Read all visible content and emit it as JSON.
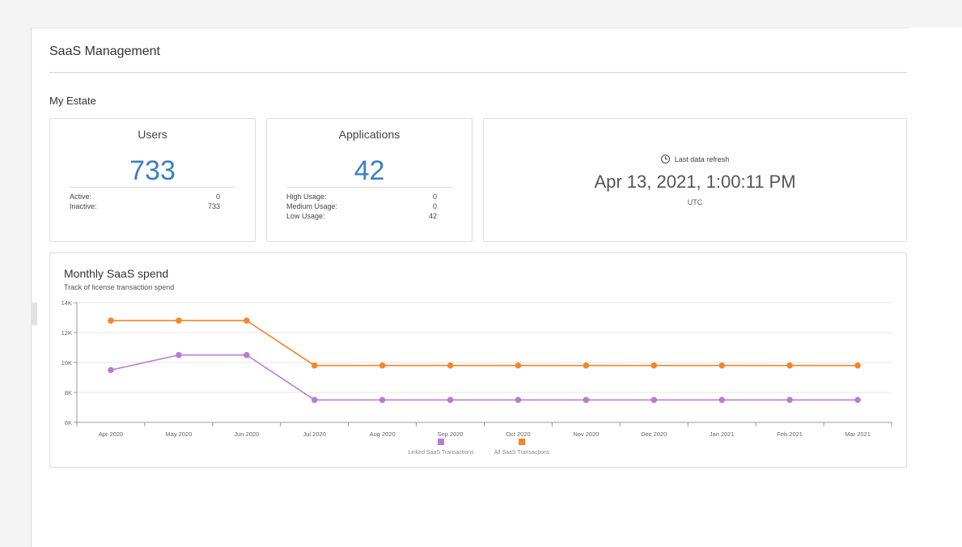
{
  "page": {
    "title": "SaaS Management",
    "section_title": "My Estate"
  },
  "users_card": {
    "heading": "Users",
    "total": "733",
    "rows": [
      {
        "label": "Active:",
        "value": "0"
      },
      {
        "label": "Inactive:",
        "value": "733"
      }
    ]
  },
  "apps_card": {
    "heading": "Applications",
    "total": "42",
    "rows": [
      {
        "label": "High Usage:",
        "value": "0"
      },
      {
        "label": "Medium Usage:",
        "value": "0"
      },
      {
        "label": "Low Usage:",
        "value": "42"
      }
    ]
  },
  "refresh_card": {
    "label": "Last data refresh",
    "value": "Apr 13, 2021, 1:00:11 PM",
    "timezone": "UTC",
    "icon": "clock-icon"
  },
  "colors": {
    "accent_number": "#3b7fc4",
    "linked_series": "#b57bd6",
    "all_series": "#f4852a"
  },
  "chart_data": {
    "type": "line",
    "title": "Monthly SaaS spend",
    "subtitle": "Track of license transaction spend",
    "categories": [
      "Apr 2020",
      "May 2020",
      "Jun 2020",
      "Jul 2020",
      "Aug 2020",
      "Sep 2020",
      "Oct 2020",
      "Nov 2020",
      "Dec 2020",
      "Jan 2021",
      "Feb 2021",
      "Mar 2021"
    ],
    "y_ticks": [
      "6K",
      "8K",
      "10K",
      "12K",
      "14K"
    ],
    "ylim": [
      6000,
      14000
    ],
    "series": [
      {
        "name": "Linked SaaS Transactions",
        "color": "#b57bd6",
        "values": [
          9500,
          10500,
          10500,
          7500,
          7500,
          7500,
          7500,
          7500,
          7500,
          7500,
          7500,
          7500
        ]
      },
      {
        "name": "All SaaS Transactions",
        "color": "#f4852a",
        "values": [
          12800,
          12800,
          12800,
          9800,
          9800,
          9800,
          9800,
          9800,
          9800,
          9800,
          9800,
          9800
        ]
      }
    ],
    "grid": true,
    "legend_position": "bottom-center"
  }
}
